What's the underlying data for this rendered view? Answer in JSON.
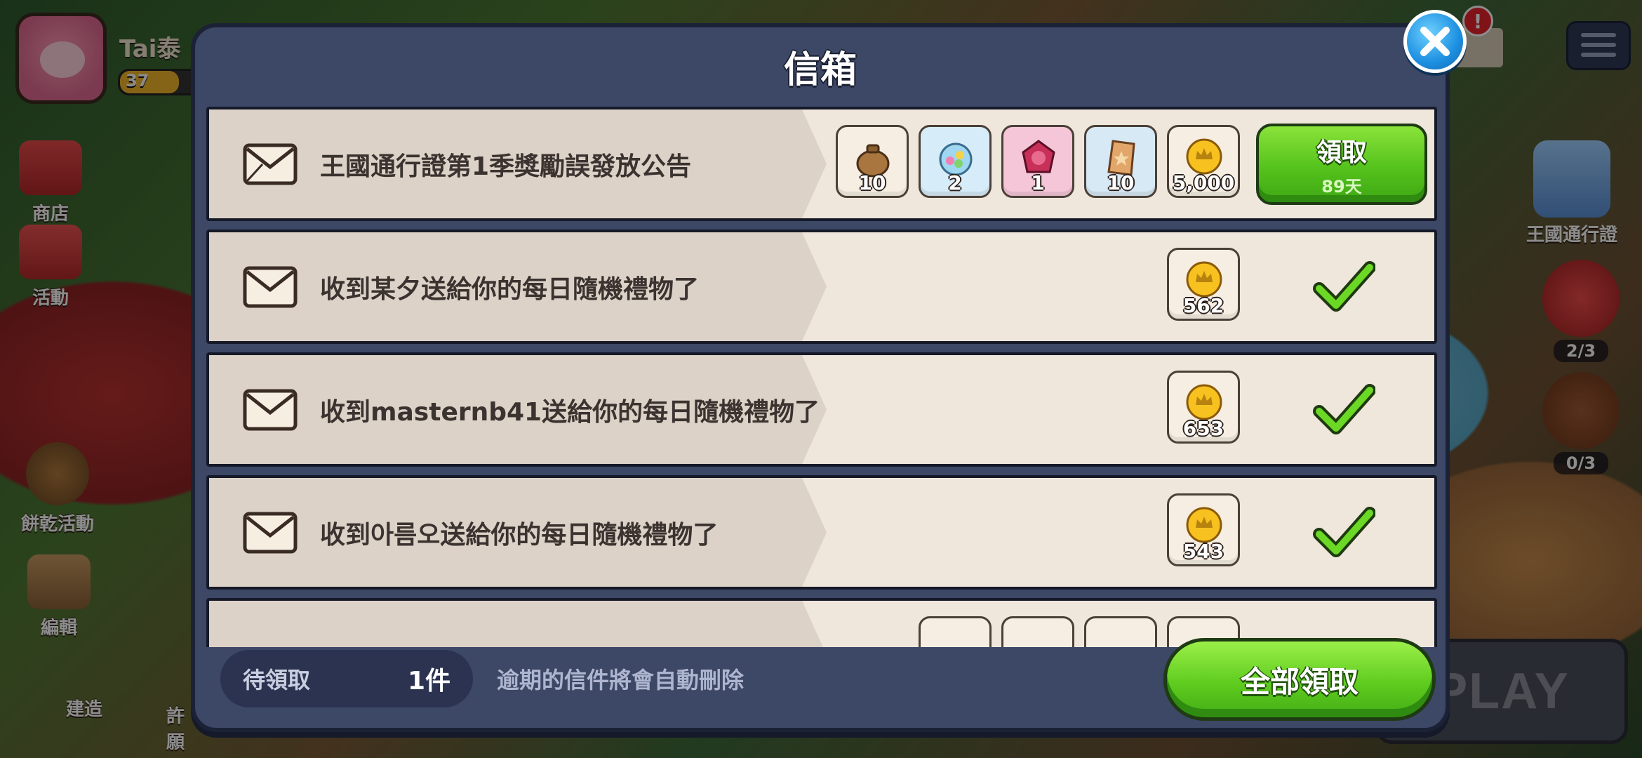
{
  "hud": {
    "player_name": "Tai泰",
    "level": "37",
    "left_buttons": [
      "商店",
      "活動",
      "餅乾活動",
      "編輯",
      "建造",
      "許願"
    ],
    "right_items": [
      {
        "label": "王國通行證"
      },
      {
        "count": "2/3"
      },
      {
        "count": "0/3"
      }
    ],
    "play_label": "PLAY",
    "mail_badge": "!"
  },
  "dialog": {
    "title": "信箱",
    "mails": [
      {
        "text": "王國通行證第1季獎勵誤發放公告",
        "rewards": [
          {
            "icon": "sack-icon",
            "qty": "10"
          },
          {
            "icon": "candy-jar-icon",
            "qty": "2"
          },
          {
            "icon": "red-gem-icon",
            "qty": "1"
          },
          {
            "icon": "ticket-icon",
            "qty": "10"
          },
          {
            "icon": "coin-icon",
            "qty": "5,000"
          }
        ],
        "claim": {
          "label": "領取",
          "days": "89天"
        }
      },
      {
        "text": "收到某夕送給你的每日隨機禮物了",
        "rewards": [
          {
            "icon": "coin-icon",
            "qty": "562"
          }
        ],
        "claimed": true
      },
      {
        "text": "收到masternb41送給你的每日隨機禮物了",
        "rewards": [
          {
            "icon": "coin-icon",
            "qty": "653"
          }
        ],
        "claimed": true
      },
      {
        "text": "收到아름오送給你的每日隨機禮物了",
        "rewards": [
          {
            "icon": "coin-icon",
            "qty": "543"
          }
        ],
        "claimed": true
      }
    ],
    "footer": {
      "pending_label": "待領取",
      "pending_count": "1件",
      "expire_note": "逾期的信件將會自動刪除",
      "claim_all_label": "全部領取"
    }
  },
  "colors": {
    "dialog_bg": "#3d4766",
    "button_green": "#55c21c",
    "close_blue": "#1c8fe0",
    "check_green": "#5fd01c"
  }
}
